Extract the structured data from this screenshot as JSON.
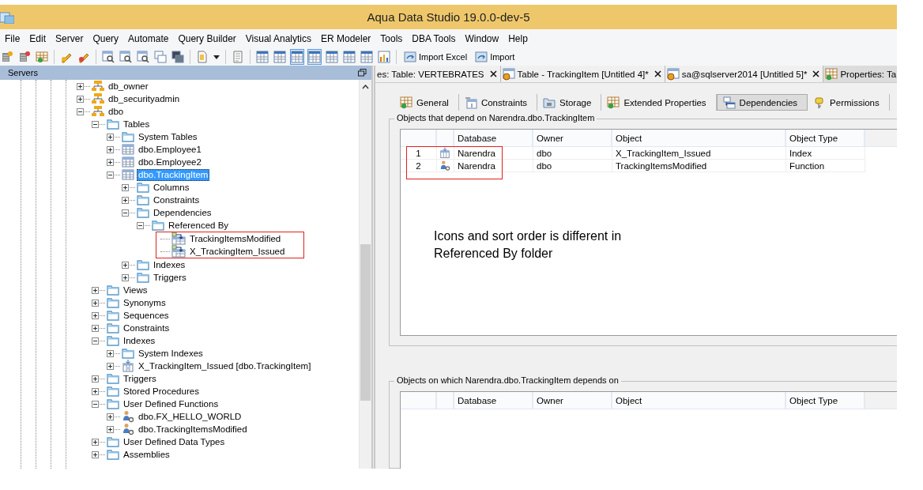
{
  "window": {
    "title": "Aqua Data Studio 19.0.0-dev-5"
  },
  "menu": [
    "File",
    "Edit",
    "Server",
    "Query",
    "Automate",
    "Query Builder",
    "Visual Analytics",
    "ER Modeler",
    "Tools",
    "DBA Tools",
    "Window",
    "Help"
  ],
  "toolbar": {
    "tools": [
      {
        "kind": "server-add",
        "pressed": false
      },
      {
        "kind": "server-remove",
        "pressed": false
      },
      {
        "kind": "grid-dot",
        "pressed": false
      },
      {
        "kind": "separator"
      },
      {
        "kind": "pen",
        "pressed": false
      },
      {
        "kind": "pen-red",
        "pressed": false
      },
      {
        "kind": "separator"
      },
      {
        "kind": "query",
        "pressed": false
      },
      {
        "kind": "query",
        "pressed": false
      },
      {
        "kind": "query",
        "pressed": false
      },
      {
        "kind": "windows",
        "pressed": false
      },
      {
        "kind": "dark-windows",
        "pressed": false
      },
      {
        "kind": "separator"
      },
      {
        "kind": "doc",
        "pressed": false
      },
      {
        "kind": "dropdown",
        "pressed": false
      },
      {
        "kind": "separator"
      },
      {
        "kind": "script",
        "pressed": false
      },
      {
        "kind": "separator"
      },
      {
        "kind": "view",
        "pressed": false
      },
      {
        "kind": "view",
        "pressed": false
      },
      {
        "kind": "view",
        "pressed": true
      },
      {
        "kind": "view",
        "pressed": true
      },
      {
        "kind": "view",
        "pressed": false
      },
      {
        "kind": "view",
        "pressed": false
      },
      {
        "kind": "view",
        "pressed": false
      },
      {
        "kind": "chart",
        "pressed": false
      },
      {
        "kind": "separator"
      }
    ],
    "buttons": [
      "Import Excel",
      "Import"
    ]
  },
  "servers_panel": {
    "title": "Servers",
    "tree": [
      {
        "label": "db_owner",
        "kind": "role",
        "expanded": false,
        "selected": false
      },
      {
        "label": "db_securityadmin",
        "kind": "role",
        "expanded": false,
        "selected": false
      },
      {
        "label": "dbo",
        "kind": "role",
        "expanded": true,
        "selected": false,
        "children": [
          {
            "label": "Tables",
            "kind": "folder",
            "expanded": true,
            "selected": false,
            "children": [
              {
                "label": "System Tables",
                "kind": "folder",
                "expanded": false,
                "selected": false
              },
              {
                "label": "dbo.Employee1",
                "kind": "table",
                "expanded": false,
                "selected": false
              },
              {
                "label": "dbo.Employee2",
                "kind": "table",
                "expanded": false,
                "selected": false
              },
              {
                "label": "dbo.TrackingItem",
                "kind": "table",
                "expanded": true,
                "selected": true,
                "children": [
                  {
                    "label": "Columns",
                    "kind": "folder",
                    "expanded": false,
                    "selected": false
                  },
                  {
                    "label": "Constraints",
                    "kind": "folder",
                    "expanded": false,
                    "selected": false
                  },
                  {
                    "label": "Dependencies",
                    "kind": "folder",
                    "expanded": true,
                    "selected": false,
                    "children": [
                      {
                        "label": "Referenced By",
                        "kind": "folder",
                        "expanded": true,
                        "selected": false,
                        "highlighted": true,
                        "children": [
                          {
                            "label": "TrackingItemsModified",
                            "kind": "dependency",
                            "selected": false
                          },
                          {
                            "label": "X_TrackingItem_Issued",
                            "kind": "dependency",
                            "selected": false
                          }
                        ]
                      }
                    ]
                  },
                  {
                    "label": "Indexes",
                    "kind": "folder",
                    "expanded": false,
                    "selected": false
                  },
                  {
                    "label": "Triggers",
                    "kind": "folder",
                    "expanded": false,
                    "selected": false
                  }
                ]
              }
            ]
          },
          {
            "label": "Views",
            "kind": "folder",
            "expanded": false,
            "selected": false
          },
          {
            "label": "Synonyms",
            "kind": "folder",
            "expanded": false,
            "selected": false
          },
          {
            "label": "Sequences",
            "kind": "folder",
            "expanded": false,
            "selected": false
          },
          {
            "label": "Constraints",
            "kind": "folder",
            "expanded": false,
            "selected": false
          },
          {
            "label": "Indexes",
            "kind": "folder",
            "expanded": true,
            "selected": false,
            "children": [
              {
                "label": "System Indexes",
                "kind": "folder",
                "expanded": false,
                "selected": false
              },
              {
                "label": "X_TrackingItem_Issued [dbo.TrackingItem]",
                "kind": "index",
                "expanded": false,
                "selected": false
              }
            ]
          },
          {
            "label": "Triggers",
            "kind": "folder",
            "expanded": false,
            "selected": false
          },
          {
            "label": "Stored Procedures",
            "kind": "folder",
            "expanded": false,
            "selected": false
          },
          {
            "label": "User Defined Functions",
            "kind": "folder",
            "expanded": true,
            "selected": false,
            "children": [
              {
                "label": "dbo.FX_HELLO_WORLD",
                "kind": "function",
                "expanded": false,
                "selected": false
              },
              {
                "label": "dbo.TrackingItemsModified",
                "kind": "function",
                "expanded": false,
                "selected": false
              }
            ]
          },
          {
            "label": "User Defined Data Types",
            "kind": "folder",
            "expanded": false,
            "selected": false
          },
          {
            "label": "Assemblies",
            "kind": "folder",
            "expanded": false,
            "selected": false
          }
        ]
      }
    ]
  },
  "document_tabs": [
    {
      "label": "es: Table: VERTEBRATES",
      "kind": "plain",
      "selected": false
    },
    {
      "label": "Table - TrackingItem [Untitled 4]*",
      "kind": "query",
      "selected": false
    },
    {
      "label": "sa@sqlserver2014 [Untitled 5]*",
      "kind": "query",
      "selected": false
    },
    {
      "label": "Properties: Ta",
      "kind": "properties",
      "selected": true
    }
  ],
  "property_tabs": [
    {
      "label": "General",
      "kind": "grid",
      "selected": false
    },
    {
      "label": "Constraints",
      "kind": "constraint",
      "selected": false
    },
    {
      "label": "Storage",
      "kind": "storage",
      "selected": false
    },
    {
      "label": "Extended Properties",
      "kind": "grid",
      "selected": false
    },
    {
      "label": "Dependencies",
      "kind": "dependency",
      "selected": true
    },
    {
      "label": "Permissions",
      "kind": "key",
      "selected": false
    }
  ],
  "dependents": {
    "title": "Objects that depend on Narendra.dbo.TrackingItem",
    "highlighted": true,
    "columns": [
      "Database",
      "Owner",
      "Object",
      "Object Type"
    ],
    "rows": [
      {
        "number": "1",
        "kind": "index",
        "database": "Narendra",
        "owner": "dbo",
        "object": "X_TrackingItem_Issued",
        "object_type": "Index"
      },
      {
        "number": "2",
        "kind": "function",
        "database": "Narendra",
        "owner": "dbo",
        "object": "TrackingItemsModified",
        "object_type": "Function"
      }
    ],
    "note": "Icons and sort order is different in Referenced By folder"
  },
  "dependencies": {
    "title": "Objects on which Narendra.dbo.TrackingItem depends on",
    "columns": [
      "Database",
      "Owner",
      "Object",
      "Object Type"
    ]
  }
}
